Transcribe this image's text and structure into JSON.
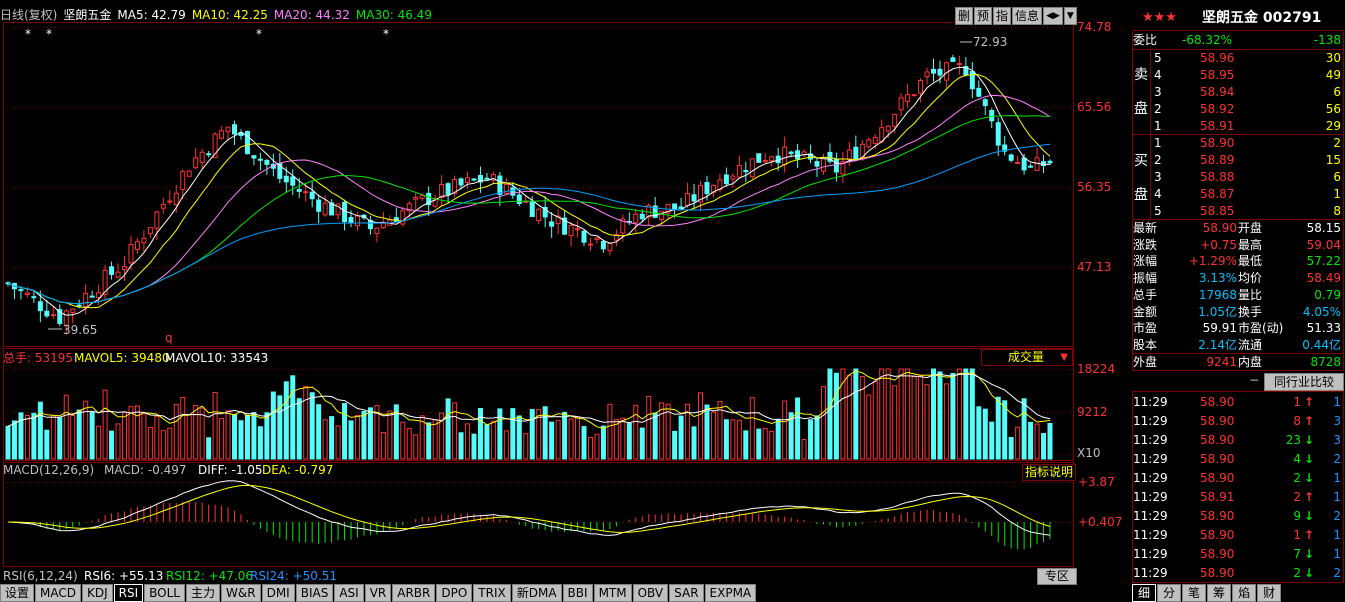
{
  "topbar": {
    "period": "日线(复权)",
    "name": "坚朗五金",
    "ma5": "MA5: 42.79",
    "ma10": "MA10: 42.25",
    "ma20": "MA20: 44.32",
    "ma30": "MA30: 46.49"
  },
  "toolbar": {
    "b1": "删",
    "b2": "预",
    "b3": "指",
    "b4": "信息",
    "b5": "◀▶",
    "b6": "▼"
  },
  "price_axis": {
    "t1": "74.78",
    "t2": "65.56",
    "t3": "56.35",
    "t4": "47.13"
  },
  "price_annot": {
    "high": "72.93",
    "low": "39.65",
    "q": "q"
  },
  "vol": {
    "label_total": "总手: 53195",
    "label_mavol5": "MAVOL5: 39480",
    "label_mavol10": "MAVOL10: 33543",
    "selector": "成交量",
    "t1": "18224",
    "t2": "9212",
    "t3": "X10"
  },
  "macd": {
    "label_name": "MACD(12,26,9)",
    "label_macd": "MACD: -0.497",
    "label_diff": "DIFF: -1.05",
    "label_dea": "DEA: -0.797",
    "help": "指标说明",
    "t1": "+3.87",
    "t2": "+0.407"
  },
  "rsi": {
    "label_name": "RSI(6,12,24)",
    "rsi6": "RSI6: +55.13",
    "rsi12": "RSI12: +47.06",
    "rsi24": "RSI24: +50.51",
    "zone": "专区"
  },
  "bottom_tabs": [
    "设置",
    "MACD",
    "KDJ",
    "RSI",
    "BOLL",
    "主力",
    "W&R",
    "DMI",
    "BIAS",
    "ASI",
    "VR",
    "ARBR",
    "DPO",
    "TRIX",
    "新DMA",
    "BBI",
    "MTM",
    "OBV",
    "SAR",
    "EXPMA"
  ],
  "right_tabs": [
    "细",
    "分",
    "笔",
    "筹",
    "焰",
    "财"
  ],
  "quote": {
    "stars": "★★★",
    "title": "坚朗五金 002791",
    "weibi_label": "委比",
    "weibi_pct": "-68.32%",
    "weibi_diff": "-138",
    "sell_label_1": "卖",
    "sell_label_2": "盘",
    "buy_label_1": "买",
    "buy_label_2": "盘",
    "sells": [
      {
        "lvl": "5",
        "price": "58.96",
        "vol": "30"
      },
      {
        "lvl": "4",
        "price": "58.95",
        "vol": "49"
      },
      {
        "lvl": "3",
        "price": "58.94",
        "vol": "6"
      },
      {
        "lvl": "2",
        "price": "58.92",
        "vol": "56"
      },
      {
        "lvl": "1",
        "price": "58.91",
        "vol": "29"
      }
    ],
    "buys": [
      {
        "lvl": "1",
        "price": "58.90",
        "vol": "2"
      },
      {
        "lvl": "2",
        "price": "58.89",
        "vol": "15"
      },
      {
        "lvl": "3",
        "price": "58.88",
        "vol": "6"
      },
      {
        "lvl": "4",
        "price": "58.87",
        "vol": "1"
      },
      {
        "lvl": "5",
        "price": "58.85",
        "vol": "8"
      }
    ],
    "stats": [
      {
        "l1": "最新",
        "v1": "58.90",
        "c1": "red",
        "l2": "开盘",
        "v2": "58.15",
        "c2": "wh"
      },
      {
        "l1": "涨跌",
        "v1": "+0.75",
        "c1": "red",
        "l2": "最高",
        "v2": "59.04",
        "c2": "red"
      },
      {
        "l1": "涨幅",
        "v1": "+1.29%",
        "c1": "red",
        "l2": "最低",
        "v2": "57.22",
        "c2": "grn"
      },
      {
        "l1": "振幅",
        "v1": "3.13%",
        "c1": "cy",
        "l2": "均价",
        "v2": "58.49",
        "c2": "red"
      },
      {
        "l1": "总手",
        "v1": "17968",
        "c1": "cy",
        "l2": "量比",
        "v2": "0.79",
        "c2": "grn"
      },
      {
        "l1": "金额",
        "v1": "1.05亿",
        "c1": "cy",
        "l2": "换手",
        "v2": "4.05%",
        "c2": "cy"
      },
      {
        "l1": "市盈",
        "v1": "59.91",
        "c1": "wh",
        "l2": "市盈(动)",
        "v2": "51.33",
        "c2": "wh"
      },
      {
        "l1": "股本",
        "v1": "2.14亿",
        "c1": "cy",
        "l2": "流通",
        "v2": "0.44亿",
        "c2": "cy"
      },
      {
        "l1": "外盘",
        "v1": "9241",
        "c1": "red",
        "l2": "内盘",
        "v2": "8728",
        "c2": "grn"
      }
    ],
    "industry_btn": "同行业比较",
    "ticks": [
      {
        "t": "11:29",
        "p": "58.90",
        "c": "red",
        "v": "1",
        "vc": "red",
        "dir": "up",
        "n": "1"
      },
      {
        "t": "11:29",
        "p": "58.90",
        "c": "red",
        "v": "8",
        "vc": "red",
        "dir": "up",
        "n": "3"
      },
      {
        "t": "11:29",
        "p": "58.90",
        "c": "red",
        "v": "23",
        "vc": "grn",
        "dir": "down",
        "n": "3"
      },
      {
        "t": "11:29",
        "p": "58.90",
        "c": "red",
        "v": "4",
        "vc": "grn",
        "dir": "down",
        "n": "2"
      },
      {
        "t": "11:29",
        "p": "58.90",
        "c": "red",
        "v": "2",
        "vc": "grn",
        "dir": "down",
        "n": "1"
      },
      {
        "t": "11:29",
        "p": "58.91",
        "c": "red",
        "v": "2",
        "vc": "red",
        "dir": "up",
        "n": "1"
      },
      {
        "t": "11:29",
        "p": "58.90",
        "c": "red",
        "v": "9",
        "vc": "grn",
        "dir": "down",
        "n": "2"
      },
      {
        "t": "11:29",
        "p": "58.90",
        "c": "red",
        "v": "1",
        "vc": "red",
        "dir": "up",
        "n": "1"
      },
      {
        "t": "11:29",
        "p": "58.90",
        "c": "red",
        "v": "7",
        "vc": "grn",
        "dir": "down",
        "n": "1"
      },
      {
        "t": "11:29",
        "p": "58.90",
        "c": "red",
        "v": "2",
        "vc": "grn",
        "dir": "down",
        "n": "2"
      }
    ]
  },
  "colors": {
    "up": "#ff3232",
    "down": "#54fcfc",
    "grid": "#800000",
    "ma5": "#ffffff",
    "ma10": "#ffff00",
    "ma20": "#ff80ff",
    "ma30": "#00e600",
    "ma60": "#00a0ff"
  },
  "chart_data": {
    "type": "candlestick",
    "ylim": [
      39.0,
      74.78
    ],
    "high": 72.93,
    "low": 39.65,
    "waypoints": [
      [
        0,
        44.5
      ],
      [
        8,
        40.5
      ],
      [
        18,
        47
      ],
      [
        28,
        58.5
      ],
      [
        34,
        63
      ],
      [
        42,
        57
      ],
      [
        48,
        54
      ],
      [
        56,
        51
      ],
      [
        66,
        55
      ],
      [
        74,
        57
      ],
      [
        84,
        52
      ],
      [
        92,
        49.5
      ],
      [
        98,
        53
      ],
      [
        104,
        53.5
      ],
      [
        110,
        57
      ],
      [
        118,
        60
      ],
      [
        128,
        58
      ],
      [
        136,
        64
      ],
      [
        142,
        69
      ],
      [
        148,
        70
      ],
      [
        154,
        60
      ],
      [
        158,
        58
      ],
      [
        161,
        58.9
      ]
    ]
  }
}
